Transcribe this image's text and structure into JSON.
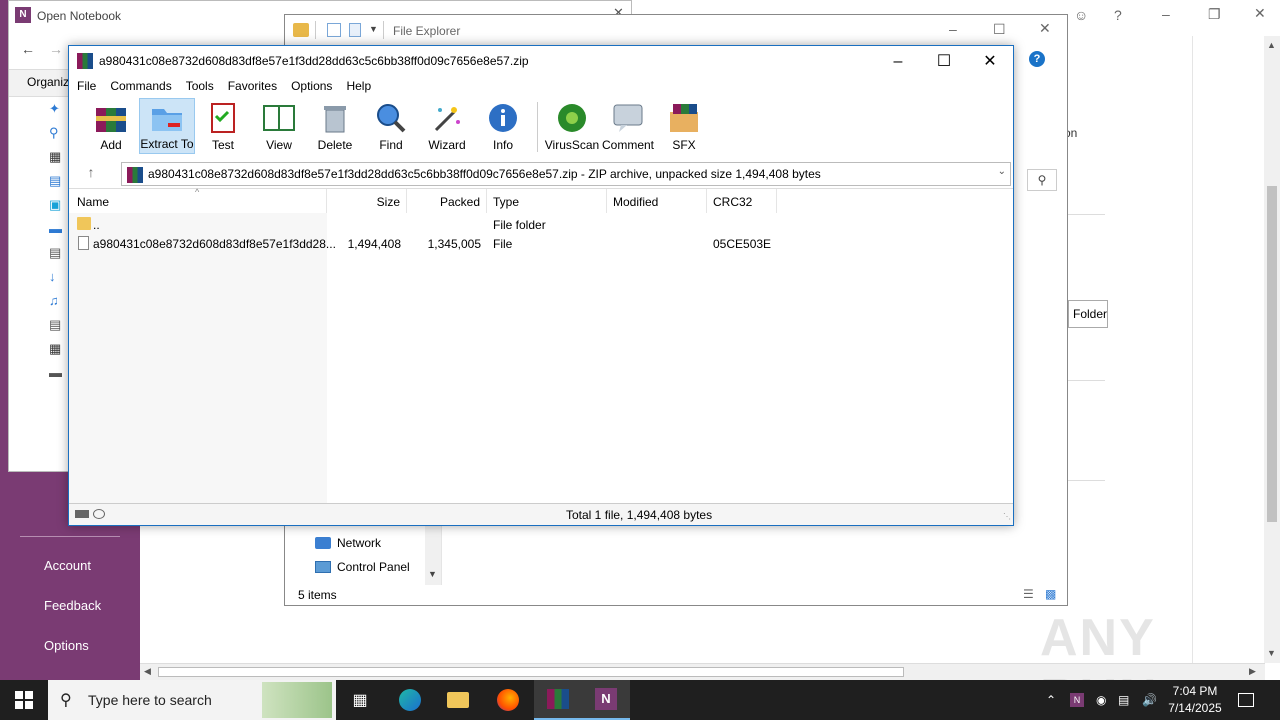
{
  "onenote": {
    "backstage": {
      "account": "Account",
      "feedback": "Feedback",
      "options": "Options"
    },
    "right_partial_text": "tion",
    "folder_button": "Folder"
  },
  "open_notebook": {
    "title": "Open Notebook",
    "organize": "Organiz"
  },
  "explorer": {
    "title": "File Explorer",
    "nav": [
      {
        "label": "Network",
        "icon": "network-icon"
      },
      {
        "label": "Control Panel",
        "icon": "control-panel-icon"
      }
    ],
    "status": "5 items"
  },
  "winrar": {
    "title": "a980431c08e8732d608d83df8e57e1f3dd28dd63c5c6bb38ff0d09c7656e8e57.zip",
    "menu": [
      "File",
      "Commands",
      "Tools",
      "Favorites",
      "Options",
      "Help"
    ],
    "toolbar": [
      {
        "label": "Add",
        "icon": "add-archive-icon"
      },
      {
        "label": "Extract To",
        "icon": "extract-to-icon"
      },
      {
        "label": "Test",
        "icon": "test-icon"
      },
      {
        "label": "View",
        "icon": "view-icon"
      },
      {
        "label": "Delete",
        "icon": "delete-icon"
      },
      {
        "label": "Find",
        "icon": "find-icon"
      },
      {
        "label": "Wizard",
        "icon": "wizard-icon"
      },
      {
        "label": "Info",
        "icon": "info-icon"
      },
      {
        "label": "VirusScan",
        "icon": "virus-scan-icon"
      },
      {
        "label": "Comment",
        "icon": "comment-icon"
      },
      {
        "label": "SFX",
        "icon": "sfx-icon"
      }
    ],
    "address": "a980431c08e8732d608d83df8e57e1f3dd28dd63c5c6bb38ff0d09c7656e8e57.zip - ZIP archive, unpacked size 1,494,408 bytes",
    "columns": [
      "Name",
      "Size",
      "Packed",
      "Type",
      "Modified",
      "CRC32"
    ],
    "rows": [
      {
        "name": "..",
        "size": "",
        "packed": "",
        "type": "File folder",
        "modified": "",
        "crc": ""
      },
      {
        "name": "a980431c08e8732d608d83df8e57e1f3dd28...",
        "size": "1,494,408",
        "packed": "1,345,005",
        "type": "File",
        "modified": "",
        "crc": "05CE503E"
      }
    ],
    "status": "Total 1 file, 1,494,408 bytes"
  },
  "taskbar": {
    "search_placeholder": "Type here to search",
    "time": "7:04 PM",
    "date": "7/14/2025"
  },
  "watermark": "ANY RUN"
}
